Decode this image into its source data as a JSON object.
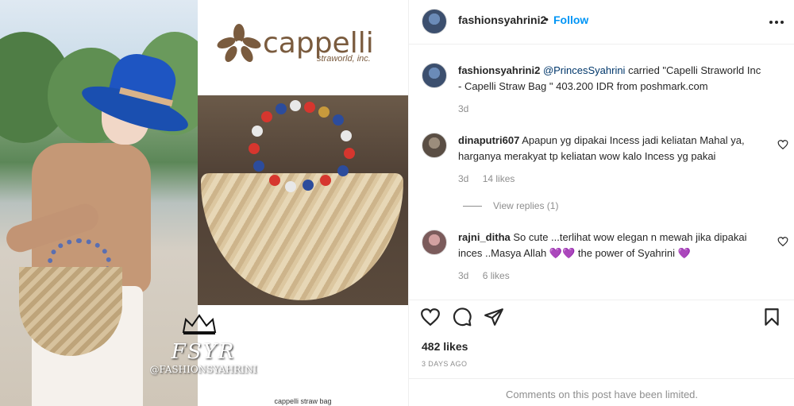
{
  "post": {
    "author": "fashionsyahrini2",
    "follow_label": "Follow",
    "separator": "•",
    "media": {
      "brand_name": "cappelli",
      "brand_sub": "straworld, inc.",
      "watermark_big": "FSYR",
      "watermark_small": "@FASHIONSYAHRINI",
      "caption": "cappelli straw bag"
    },
    "caption": {
      "username": "fashionsyahrini2",
      "mention": "@PrincesSyahrini",
      "text": " carried \"Capelli Straworld Inc - Capelli Straw Bag \" 403.200 IDR from poshmark.com",
      "time": "3d"
    },
    "comments": [
      {
        "username": "dinaputri607",
        "text": " Apapun yg dipakai Incess jadi keliatan Mahal ya, harganya merakyat tp keliatan wow kalo Incess yg pakai",
        "time": "3d",
        "likes": "14 likes",
        "replies": "View replies (1)"
      },
      {
        "username": "rajni_ditha",
        "text": " So cute ...terlihat wow elegan n mewah jika dipakai inces ..Masya Allah 💜💜 the power of Syahrini 💜",
        "time": "3d",
        "likes": "6 likes"
      }
    ],
    "likes": "482 likes",
    "ago": "3 DAYS AGO",
    "limited_notice": "Comments on this post have been limited."
  },
  "icons": [
    "more-icon",
    "heart-icon",
    "comment-icon",
    "share-icon",
    "bookmark-icon"
  ],
  "colors": {
    "link": "#0095f6",
    "mention": "#00376b",
    "muted": "#8e8e8e",
    "heart_purple": "#8a4fd8"
  }
}
